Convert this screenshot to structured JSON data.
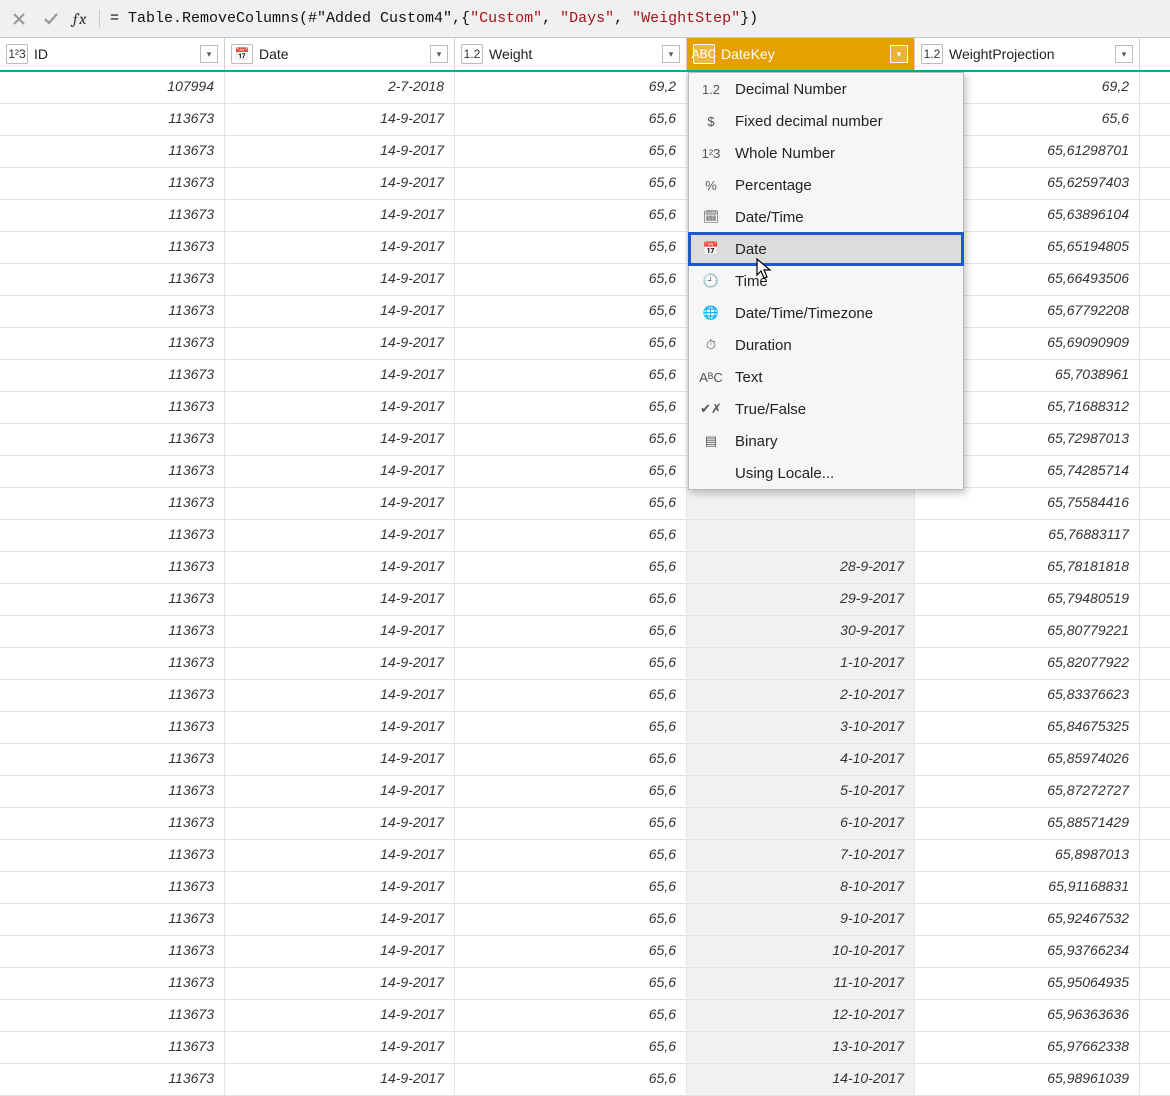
{
  "formula": {
    "prefix": "= Table.RemoveColumns(#\"Added Custom4\",{",
    "s1": "\"Custom\"",
    "c1": ", ",
    "s2": "\"Days\"",
    "c2": ", ",
    "s3": "\"WeightStep\"",
    "suffix": "})"
  },
  "columns": {
    "id": {
      "name": "ID",
      "type_icon": "1²3"
    },
    "date": {
      "name": "Date",
      "type_icon": "📅"
    },
    "w": {
      "name": "Weight",
      "type_icon": "1.2"
    },
    "dk": {
      "name": "DateKey",
      "type_icon": "ABC"
    },
    "wp": {
      "name": "WeightProjection",
      "type_icon": "1.2"
    }
  },
  "dropdown": [
    {
      "icon": "1.2",
      "label": "Decimal Number"
    },
    {
      "icon": "$",
      "label": "Fixed decimal number"
    },
    {
      "icon": "1²3",
      "label": "Whole Number"
    },
    {
      "icon": "%",
      "label": "Percentage"
    },
    {
      "icon": "🗓",
      "label": "Date/Time"
    },
    {
      "icon": "📅",
      "label": "Date",
      "highlight": true
    },
    {
      "icon": "🕘",
      "label": "Time"
    },
    {
      "icon": "🌐",
      "label": "Date/Time/Timezone"
    },
    {
      "icon": "⏱",
      "label": "Duration"
    },
    {
      "icon": "AᴮC",
      "label": "Text"
    },
    {
      "icon": "✔✗",
      "label": "True/False"
    },
    {
      "icon": "▤",
      "label": "Binary"
    },
    {
      "icon": "",
      "label": "Using Locale..."
    }
  ],
  "rows": [
    {
      "id": "107994",
      "date": "2-7-2018",
      "w": "69,2",
      "dk": "",
      "wp": "69,2"
    },
    {
      "id": "113673",
      "date": "14-9-2017",
      "w": "65,6",
      "dk": "",
      "wp": "65,6"
    },
    {
      "id": "113673",
      "date": "14-9-2017",
      "w": "65,6",
      "dk": "",
      "wp": "65,61298701"
    },
    {
      "id": "113673",
      "date": "14-9-2017",
      "w": "65,6",
      "dk": "",
      "wp": "65,62597403"
    },
    {
      "id": "113673",
      "date": "14-9-2017",
      "w": "65,6",
      "dk": "",
      "wp": "65,63896104"
    },
    {
      "id": "113673",
      "date": "14-9-2017",
      "w": "65,6",
      "dk": "",
      "wp": "65,65194805"
    },
    {
      "id": "113673",
      "date": "14-9-2017",
      "w": "65,6",
      "dk": "",
      "wp": "65,66493506"
    },
    {
      "id": "113673",
      "date": "14-9-2017",
      "w": "65,6",
      "dk": "",
      "wp": "65,67792208"
    },
    {
      "id": "113673",
      "date": "14-9-2017",
      "w": "65,6",
      "dk": "",
      "wp": "65,69090909"
    },
    {
      "id": "113673",
      "date": "14-9-2017",
      "w": "65,6",
      "dk": "",
      "wp": "65,7038961"
    },
    {
      "id": "113673",
      "date": "14-9-2017",
      "w": "65,6",
      "dk": "",
      "wp": "65,71688312"
    },
    {
      "id": "113673",
      "date": "14-9-2017",
      "w": "65,6",
      "dk": "",
      "wp": "65,72987013"
    },
    {
      "id": "113673",
      "date": "14-9-2017",
      "w": "65,6",
      "dk": "",
      "wp": "65,74285714"
    },
    {
      "id": "113673",
      "date": "14-9-2017",
      "w": "65,6",
      "dk": "",
      "wp": "65,75584416"
    },
    {
      "id": "113673",
      "date": "14-9-2017",
      "w": "65,6",
      "dk": "",
      "wp": "65,76883117"
    },
    {
      "id": "113673",
      "date": "14-9-2017",
      "w": "65,6",
      "dk": "28-9-2017",
      "wp": "65,78181818"
    },
    {
      "id": "113673",
      "date": "14-9-2017",
      "w": "65,6",
      "dk": "29-9-2017",
      "wp": "65,79480519"
    },
    {
      "id": "113673",
      "date": "14-9-2017",
      "w": "65,6",
      "dk": "30-9-2017",
      "wp": "65,80779221"
    },
    {
      "id": "113673",
      "date": "14-9-2017",
      "w": "65,6",
      "dk": "1-10-2017",
      "wp": "65,82077922"
    },
    {
      "id": "113673",
      "date": "14-9-2017",
      "w": "65,6",
      "dk": "2-10-2017",
      "wp": "65,83376623"
    },
    {
      "id": "113673",
      "date": "14-9-2017",
      "w": "65,6",
      "dk": "3-10-2017",
      "wp": "65,84675325"
    },
    {
      "id": "113673",
      "date": "14-9-2017",
      "w": "65,6",
      "dk": "4-10-2017",
      "wp": "65,85974026"
    },
    {
      "id": "113673",
      "date": "14-9-2017",
      "w": "65,6",
      "dk": "5-10-2017",
      "wp": "65,87272727"
    },
    {
      "id": "113673",
      "date": "14-9-2017",
      "w": "65,6",
      "dk": "6-10-2017",
      "wp": "65,88571429"
    },
    {
      "id": "113673",
      "date": "14-9-2017",
      "w": "65,6",
      "dk": "7-10-2017",
      "wp": "65,8987013"
    },
    {
      "id": "113673",
      "date": "14-9-2017",
      "w": "65,6",
      "dk": "8-10-2017",
      "wp": "65,91168831"
    },
    {
      "id": "113673",
      "date": "14-9-2017",
      "w": "65,6",
      "dk": "9-10-2017",
      "wp": "65,92467532"
    },
    {
      "id": "113673",
      "date": "14-9-2017",
      "w": "65,6",
      "dk": "10-10-2017",
      "wp": "65,93766234"
    },
    {
      "id": "113673",
      "date": "14-9-2017",
      "w": "65,6",
      "dk": "11-10-2017",
      "wp": "65,95064935"
    },
    {
      "id": "113673",
      "date": "14-9-2017",
      "w": "65,6",
      "dk": "12-10-2017",
      "wp": "65,96363636"
    },
    {
      "id": "113673",
      "date": "14-9-2017",
      "w": "65,6",
      "dk": "13-10-2017",
      "wp": "65,97662338"
    },
    {
      "id": "113673",
      "date": "14-9-2017",
      "w": "65,6",
      "dk": "14-10-2017",
      "wp": "65,98961039"
    }
  ]
}
